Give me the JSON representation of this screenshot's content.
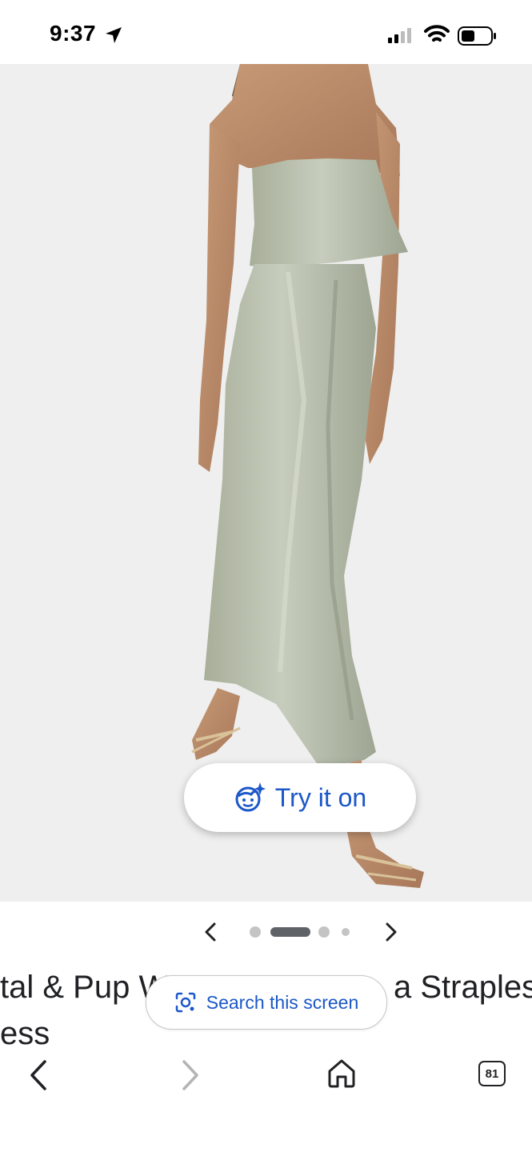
{
  "status_bar": {
    "time": "9:37"
  },
  "product": {
    "image_alt": "Sage green satin strapless midi dress worn by model",
    "dress_color": "#b9c0ae",
    "try_on_label": "Try it on",
    "title_line1": "tal & Pup W",
    "title_line1_right": "a Straples",
    "title_line2": "ess"
  },
  "carousel": {
    "count": 4,
    "active_index": 1
  },
  "lens": {
    "search_label": "Search this screen"
  },
  "nav": {
    "tab_count": "81"
  },
  "colors": {
    "accent": "#1a57c8",
    "text": "#202124",
    "hero_bg": "#efefef"
  }
}
